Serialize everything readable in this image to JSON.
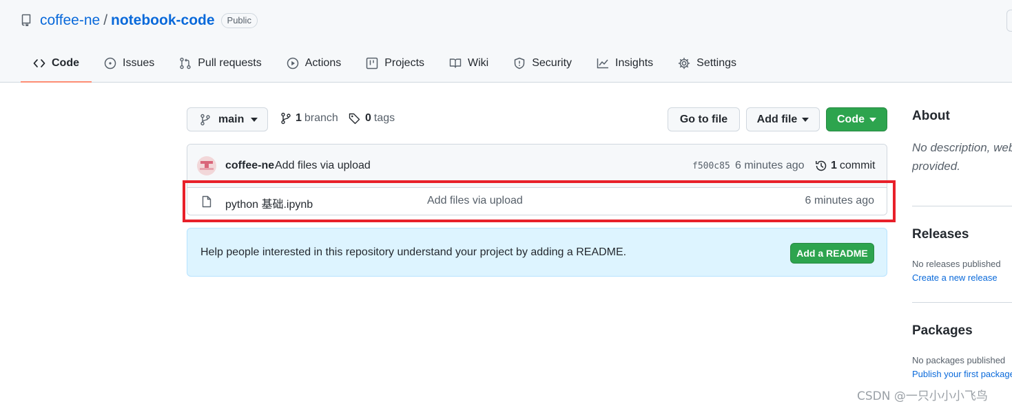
{
  "repo": {
    "owner": "coffee-ne",
    "separator": "/",
    "name": "notebook-code",
    "visibility": "Public"
  },
  "tabs": [
    {
      "label": "Code",
      "icon": "code-icon"
    },
    {
      "label": "Issues",
      "icon": "issue-opened-icon"
    },
    {
      "label": "Pull requests",
      "icon": "git-pull-request-icon"
    },
    {
      "label": "Actions",
      "icon": "play-icon"
    },
    {
      "label": "Projects",
      "icon": "table-icon"
    },
    {
      "label": "Wiki",
      "icon": "book-icon"
    },
    {
      "label": "Security",
      "icon": "shield-icon"
    },
    {
      "label": "Insights",
      "icon": "graph-icon"
    },
    {
      "label": "Settings",
      "icon": "gear-icon"
    }
  ],
  "selected_tab": "Code",
  "filenav": {
    "branch": "main",
    "branch_count": "1",
    "branch_word": "branch",
    "tag_count": "0",
    "tag_word": "tags",
    "go_to_file": "Go to file",
    "add_file": "Add file",
    "code": "Code"
  },
  "latest_commit": {
    "author": "coffee-ne",
    "message": "Add files via upload",
    "sha": "f500c85",
    "age": "6 minutes ago",
    "commit_count": "1",
    "commit_word": "commit"
  },
  "files": [
    {
      "name": "python 基础.ipynb",
      "message": "Add files via upload",
      "age": "6 minutes ago",
      "icon": "file-icon"
    }
  ],
  "readme_banner": {
    "text": "Help people interested in this repository understand your project by adding a README.",
    "button": "Add a README"
  },
  "sidebar": {
    "about_title": "About",
    "about_desc_line1": "No description, website, or topics",
    "about_desc_line2": "provided.",
    "releases_title": "Releases",
    "releases_none": "No releases published",
    "releases_link": "Create a new release",
    "packages_title": "Packages",
    "packages_none": "No packages published",
    "packages_link": "Publish your first package"
  },
  "watermark": "CSDN @一只小小小飞鸟",
  "colors": {
    "link": "#0969da",
    "primary_button": "#2da44e",
    "selected_tab_underline": "#fd8c73",
    "highlight_annotation": "#e8202a",
    "banner_bg": "#ddf4ff"
  }
}
